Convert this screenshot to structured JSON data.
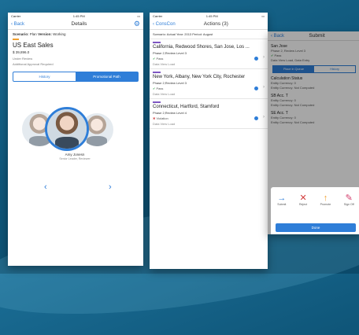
{
  "colors": {
    "accent": "#2f7ed8",
    "orange": "#f0a030",
    "purple": "#7e57c2",
    "ok": "#3aa64a",
    "bad": "#d23b3b"
  },
  "status": {
    "carrier": "Carrier",
    "time": "1:45 PM"
  },
  "details": {
    "back": "Back",
    "title": "Details",
    "gear_icon": "gear-icon",
    "scenario_label": "Scenario:",
    "scenario": "Plan",
    "version_label": "Version:",
    "version": "Working",
    "entity": "US East Sales",
    "amount": "$ 39,896.0",
    "line1": "Under Review",
    "line2": "Additional Approval Required",
    "seg_history": "History",
    "seg_path": "Promotional Path",
    "person_name": "Amy Jonesn",
    "person_role": "Senior Leader, Reviewer",
    "left_arrow": "‹",
    "right_arrow": "›"
  },
  "actions": {
    "back": "ConsCon",
    "title": "Actions (3)",
    "scenario_text": "Scenario: Actual  Year: 2013  Period: August",
    "items": [
      {
        "title": "California, Redwood Shores, San Jose, Los ...",
        "phase": "Phase 2,Review Level 3",
        "status": "Pass",
        "link": "Data View Load"
      },
      {
        "title": "New York, Albany, New York City, Rochester",
        "phase": "Phase 2,Review Level 3",
        "status": "Pass",
        "link": "Data View Load"
      },
      {
        "title": "Connecticut, Hartford, Stamford",
        "phase": "Phase 2,Review Level 4",
        "status": "Violation",
        "link": "Data View Load"
      }
    ]
  },
  "submit": {
    "back": "Back",
    "title": "Submit",
    "entity": "San Jose",
    "phase": "Phase 2, Review Level 3",
    "status": "Pass",
    "sub": "Data View Load, Data Entry",
    "seg_a": "Place in Queue",
    "seg_b": "History",
    "sections": [
      {
        "title": "Calculation Status",
        "lines": [
          "Entity Currency: 0",
          "Entity Currency: Not Computed"
        ]
      },
      {
        "title": "SB Acc. T",
        "lines": [
          "Entity Currency: 0",
          "Entity Currency: Not Computed"
        ]
      },
      {
        "title": "SE Acc. T",
        "lines": [
          "Entity Currency: 0",
          "Entity Currency: Not Computed"
        ]
      }
    ],
    "actions": [
      {
        "label": "Submit",
        "icon": "→"
      },
      {
        "label": "Reject",
        "icon": "✕"
      },
      {
        "label": "Promote",
        "icon": "↑"
      },
      {
        "label": "Sign Off",
        "icon": "✎"
      }
    ],
    "done": "Done"
  }
}
